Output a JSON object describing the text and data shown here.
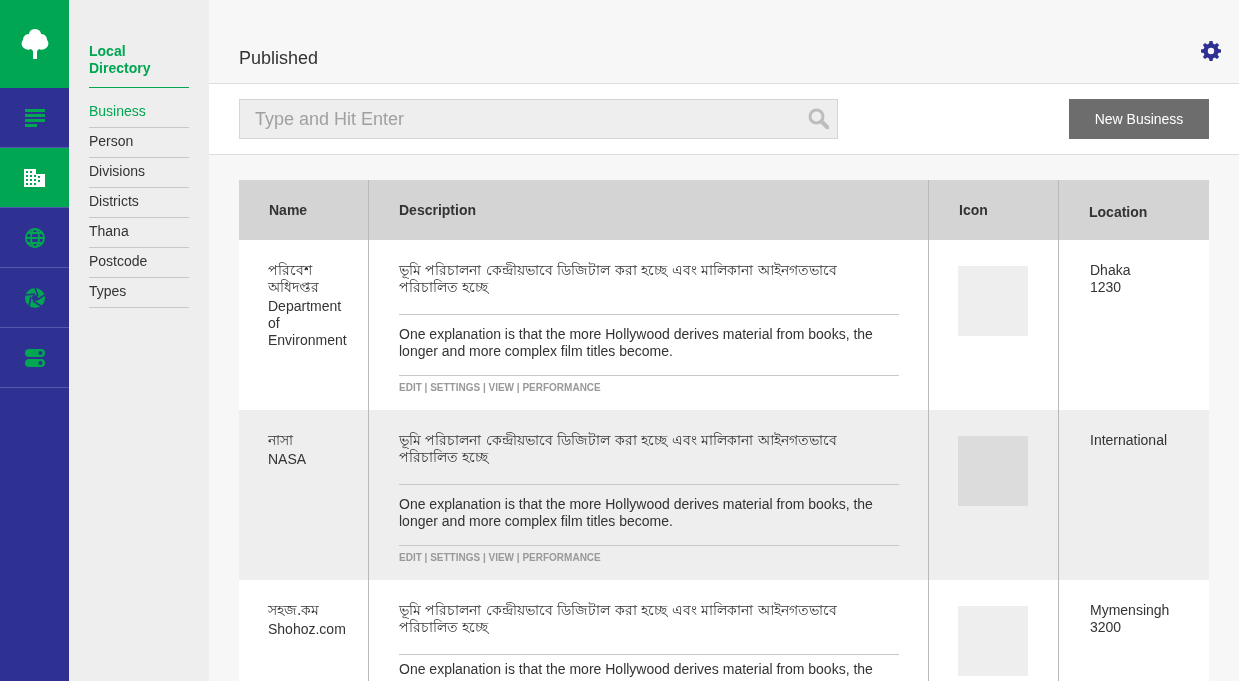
{
  "rail": {
    "items": [
      {
        "kind": "lines",
        "selected": false
      },
      {
        "kind": "building",
        "selected": true
      },
      {
        "kind": "globe",
        "selected": false
      },
      {
        "kind": "aperture",
        "selected": false
      },
      {
        "kind": "toggles",
        "selected": false
      }
    ]
  },
  "sidebar": {
    "title": "Local Directory",
    "items": [
      {
        "label": "Business",
        "selected": true
      },
      {
        "label": "Person",
        "selected": false
      },
      {
        "label": "Divisions",
        "selected": false
      },
      {
        "label": "Districts",
        "selected": false
      },
      {
        "label": "Thana",
        "selected": false
      },
      {
        "label": "Postcode",
        "selected": false
      },
      {
        "label": "Types",
        "selected": false
      }
    ]
  },
  "header": {
    "title": "Published"
  },
  "search": {
    "placeholder": "Type and Hit Enter"
  },
  "new_button": "New Business",
  "table": {
    "columns": [
      "Name",
      "Description",
      "Icon",
      "Location"
    ],
    "rows": [
      {
        "name_bn": "পরিবেশ অধিদপ্তর",
        "name_en": "Department of Environment",
        "desc_bn": "ভূমি পরিচালনা কেন্দ্রীয়ভাবে ডিজিটাল করা হচ্ছে এবং মালিকানা আইনগতভাবে পরিচালিত হচ্ছে",
        "desc_en": "One explanation is that the more Hollywood derives material from books, the longer and more complex film titles become.",
        "actions": "EDIT | SETTINGS | VIEW | PERFORMANCE",
        "location": [
          "Dhaka",
          "1230"
        ]
      },
      {
        "name_bn": "নাসা",
        "name_en": "NASA",
        "desc_bn": "ভূমি পরিচালনা কেন্দ্রীয়ভাবে ডিজিটাল করা হচ্ছে এবং মালিকানা আইনগতভাবে পরিচালিত হচ্ছে",
        "desc_en": "One explanation is that the more Hollywood derives material from books, the longer and more complex film titles become.",
        "actions": "EDIT | SETTINGS | VIEW | PERFORMANCE",
        "location": [
          "International"
        ]
      },
      {
        "name_bn": "সহজ.কম",
        "name_en": "Shohoz.com",
        "desc_bn": "ভূমি পরিচালনা কেন্দ্রীয়ভাবে ডিজিটাল করা হচ্ছে এবং মালিকানা আইনগতভাবে পরিচালিত হচ্ছে",
        "desc_en": "One explanation is that the more Hollywood derives material from books, the",
        "location": [
          "Mymensingh",
          "3200"
        ]
      }
    ]
  }
}
